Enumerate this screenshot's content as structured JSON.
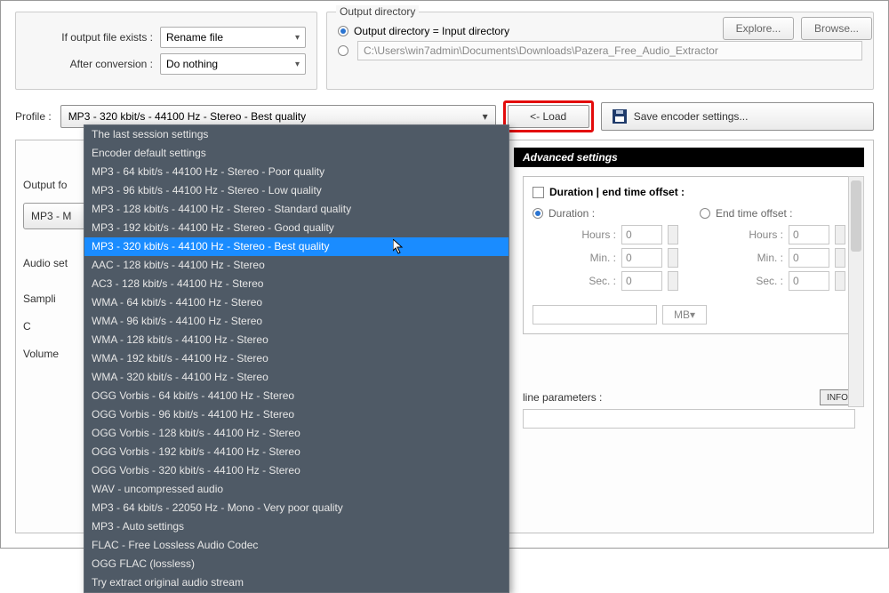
{
  "top": {
    "if_exists_label": "If output file exists :",
    "if_exists_value": "Rename file",
    "after_conv_label": "After conversion :",
    "after_conv_value": "Do nothing"
  },
  "outdir": {
    "title": "Output directory",
    "opt1_label": "Output directory = Input directory",
    "opt1_checked": true,
    "opt2_path": "C:\\Users\\win7admin\\Documents\\Downloads\\Pazera_Free_Audio_Extractor",
    "explore": "Explore...",
    "browse": "Browse..."
  },
  "profile": {
    "label": "Profile :",
    "value": "MP3 - 320 kbit/s - 44100 Hz - Stereo - Best quality",
    "load": "<- Load",
    "save": "Save encoder settings...",
    "options": [
      "The last session settings",
      "Encoder default settings",
      "MP3 - 64 kbit/s - 44100 Hz - Stereo - Poor quality",
      "MP3 - 96 kbit/s - 44100 Hz - Stereo - Low quality",
      "MP3 - 128 kbit/s - 44100 Hz - Stereo - Standard quality",
      "MP3 - 192 kbit/s - 44100 Hz - Stereo - Good quality",
      "MP3 - 320 kbit/s - 44100 Hz - Stereo - Best quality",
      "AAC - 128 kbit/s - 44100 Hz - Stereo",
      "AC3 - 128 kbit/s - 44100 Hz - Stereo",
      "WMA - 64 kbit/s - 44100 Hz - Stereo",
      "WMA - 96 kbit/s - 44100 Hz - Stereo",
      "WMA - 128 kbit/s - 44100 Hz - Stereo",
      "WMA - 192 kbit/s - 44100 Hz - Stereo",
      "WMA - 320 kbit/s - 44100 Hz - Stereo",
      "OGG Vorbis - 64 kbit/s - 44100 Hz - Stereo",
      "OGG Vorbis - 96 kbit/s - 44100 Hz - Stereo",
      "OGG Vorbis - 128 kbit/s - 44100 Hz - Stereo",
      "OGG Vorbis - 192 kbit/s - 44100 Hz - Stereo",
      "OGG Vorbis - 320 kbit/s - 44100 Hz - Stereo",
      "WAV - uncompressed audio",
      "MP3 - 64 kbit/s - 22050 Hz - Mono - Very poor quality",
      "MP3 - Auto settings",
      "FLAC - Free Lossless Audio Codec",
      "OGG FLAC (lossless)",
      "Try extract original audio stream"
    ],
    "selected_index": 6
  },
  "left": {
    "output_format_label": "Output fo",
    "codec_button": "MP3 - M",
    "audio_settings_label": "Audio set",
    "sampling_label": "Sampli",
    "c_label": "C",
    "volume_label": "Volume"
  },
  "adv": {
    "header": "Advanced settings",
    "section_title": "Duration | end time offset :",
    "duration_label": "Duration :",
    "endtime_label": "End time offset :",
    "hours": "Hours :",
    "min": "Min. :",
    "sec": "Sec. :",
    "zero": "0",
    "mb": "MB",
    "params_label": "line parameters :",
    "info": "INFO"
  }
}
